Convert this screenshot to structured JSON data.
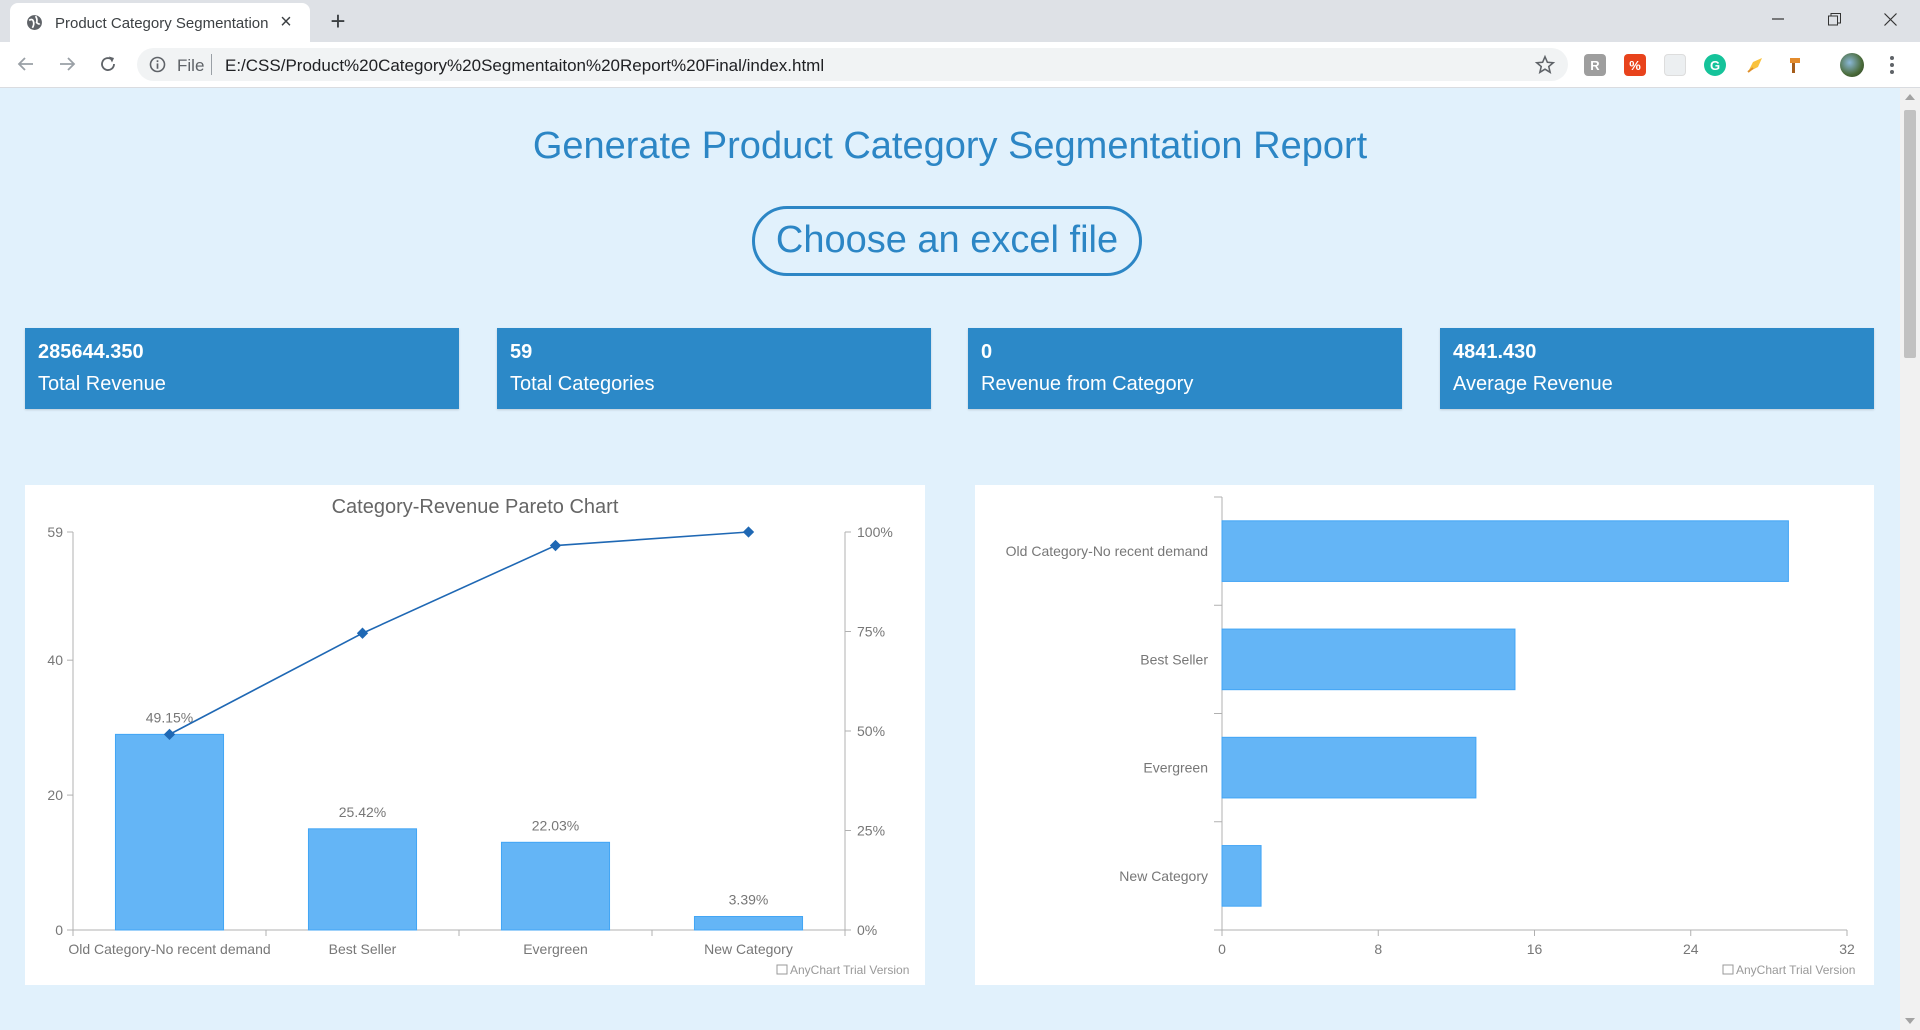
{
  "browser": {
    "tab_title": "Product Category Segmentation",
    "url_scheme": "File",
    "url": "E:/CSS/Product%20Category%20Segmentaiton%20Report%20Final/index.html",
    "extensions": [
      "rx-icon",
      "pdf-icon",
      "grid-icon",
      "grammarly-icon",
      "highlighter-icon",
      "tools-icon"
    ]
  },
  "page": {
    "title": "Generate Product Category Segmentation Report",
    "choose_button": "Choose an excel file"
  },
  "cards": [
    {
      "value": "285644.350",
      "label": "Total Revenue"
    },
    {
      "value": "59",
      "label": "Total Categories"
    },
    {
      "value": "0",
      "label": "Revenue from Category"
    },
    {
      "value": "4841.430",
      "label": "Average Revenue"
    }
  ],
  "colors": {
    "accent": "#2c86c5",
    "card": "#2c89c8",
    "bar": "#64b5f6",
    "bar_stroke": "#42a5f5",
    "line": "#1f68b4",
    "background": "#e1f1fc"
  },
  "chart_data": [
    {
      "type": "bar",
      "title": "Category-Revenue Pareto Chart",
      "categories": [
        "Old Category-No recent demand",
        "Best Seller",
        "Evergreen",
        "New Category"
      ],
      "values": [
        29,
        15,
        13,
        2
      ],
      "bar_labels": [
        "49.15%",
        "25.42%",
        "22.03%",
        "3.39%"
      ],
      "cumulative_percent": [
        49.15,
        74.57,
        96.6,
        100
      ],
      "ylim": [
        0,
        59
      ],
      "y_ticks": [
        "0",
        "20",
        "40",
        "59"
      ],
      "y2_ticks": [
        "0%",
        "25%",
        "50%",
        "75%",
        "100%"
      ],
      "grid": false,
      "watermark": "AnyChart Trial Version"
    },
    {
      "type": "bar",
      "orientation": "horizontal",
      "categories": [
        "Old Category-No recent demand",
        "Best Seller",
        "Evergreen",
        "New Category"
      ],
      "values": [
        29,
        15,
        13,
        2
      ],
      "xlim": [
        0,
        32
      ],
      "x_ticks": [
        "0",
        "8",
        "16",
        "24",
        "32"
      ],
      "grid": false,
      "watermark": "AnyChart Trial Version"
    }
  ]
}
